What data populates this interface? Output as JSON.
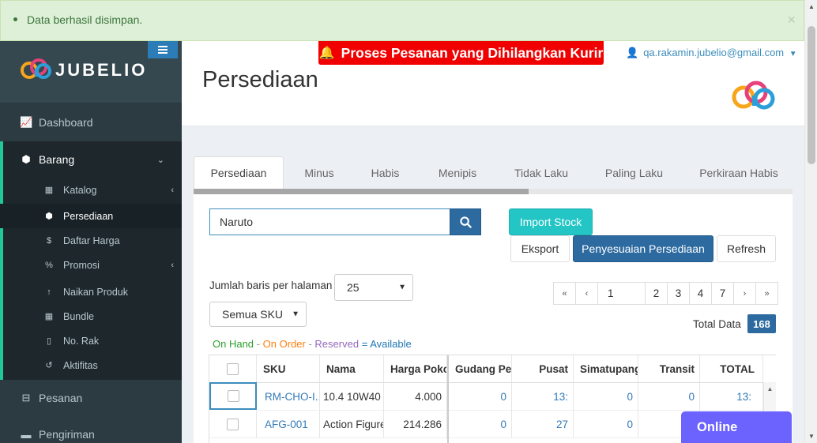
{
  "alert": {
    "message": "Data berhasil disimpan.",
    "close": "×"
  },
  "brand": {
    "name": "JUBELIO"
  },
  "sidebar": {
    "main_items": [
      {
        "label": "Dashboard",
        "icon": "area-chart-icon"
      },
      {
        "label": "Barang",
        "icon": "cubes-icon"
      },
      {
        "label": "Pesanan",
        "icon": "shopping-basket-icon"
      },
      {
        "label": "Pengiriman",
        "icon": "truck-icon"
      }
    ],
    "sub_items": [
      {
        "label": "Katalog",
        "icon": "th-icon"
      },
      {
        "label": "Persediaan",
        "icon": "cubes-icon"
      },
      {
        "label": "Daftar Harga",
        "icon": "dollar-icon"
      },
      {
        "label": "Promosi",
        "icon": "percent-icon"
      },
      {
        "label": "Naikan Produk",
        "icon": "arrow-up-icon"
      },
      {
        "label": "Bundle",
        "icon": "bundle-icon"
      },
      {
        "label": "No. Rak",
        "icon": "bookmark-icon"
      },
      {
        "label": "Aktifitas",
        "icon": "history-icon"
      }
    ]
  },
  "header": {
    "banner": "Proses Pesanan yang Dihilangkan Kurir",
    "user_email": "qa.rakamin.jubelio@gmail.com",
    "page_title": "Persediaan"
  },
  "tabs": [
    "Persediaan",
    "Minus",
    "Habis",
    "Menipis",
    "Tidak Laku",
    "Paling Laku",
    "Perkiraan Habis"
  ],
  "tab_scroll_fraction": 0.56,
  "search": {
    "value": "Naruto"
  },
  "buttons": {
    "import": "Import Stock",
    "export": "Eksport",
    "adjust": "Penyesuaian Persediaan",
    "refresh": "Refresh"
  },
  "rows_per_page": {
    "label": "Jumlah baris per halaman",
    "value": "25"
  },
  "sku_filter": {
    "value": "Semua SKU"
  },
  "pagination": {
    "first": "«",
    "prev": "‹",
    "current": "1",
    "pages": [
      "2",
      "3",
      "4",
      "7"
    ],
    "next": "›",
    "last": "»"
  },
  "total": {
    "label": "Total Data",
    "value": "168"
  },
  "legend": {
    "on_hand": "On Hand",
    "on_order": "On Order",
    "reserved": "Reserved",
    "available": "Available",
    "sep": "-",
    "eq": "="
  },
  "table": {
    "columns": [
      "SKU",
      "Nama",
      "Harga Pokok",
      "Gudang Pe",
      "Pusat",
      "Simatupang",
      "Transit",
      "TOTAL"
    ],
    "rows": [
      {
        "sku": "RM-CHO-I...",
        "nama": "10.4 10W40",
        "harga": "4.000",
        "gudang": "0",
        "pusat": "13:",
        "simatupang": "0",
        "transit": "0",
        "total": "13:"
      },
      {
        "sku": "AFG-001",
        "nama": "Action Figure",
        "harga": "214.286",
        "gudang": "0",
        "pusat": "27",
        "simatupang": "0",
        "transit": "",
        "total": ""
      }
    ]
  },
  "chat": {
    "label": "Online"
  },
  "colors": {
    "sidebar": "#2c3b41",
    "accent": "#20c997",
    "primary": "#2c6aa0",
    "banner": "#f00000",
    "chat": "#6c63ff"
  }
}
